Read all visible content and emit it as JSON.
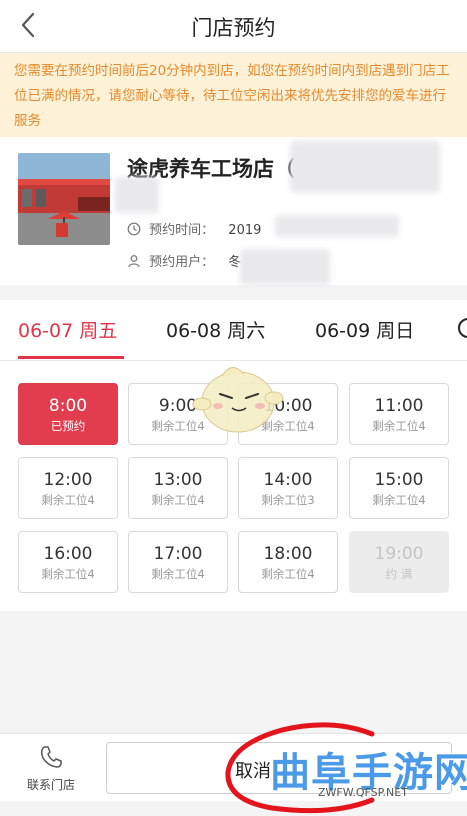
{
  "header": {
    "title": "门店预约"
  },
  "notice": {
    "text": "您需要在预约时间前后20分钟内到店，如您在预约时间内到店遇到门店工位已满的情况，请您耐心等待，待工位空闲出来将优先安排您的爱车进行服务"
  },
  "store": {
    "name": "途虎养车工场店（石",
    "time_label": "预约时间：",
    "time_value": "2019",
    "user_label": "预约用户：",
    "user_value": "冬"
  },
  "dates": [
    {
      "label": "06-07 周五",
      "active": true
    },
    {
      "label": "06-08 周六",
      "active": false
    },
    {
      "label": "06-09 周日",
      "active": false
    }
  ],
  "slots": [
    {
      "time": "8:00",
      "status": "已预约",
      "state": "booked"
    },
    {
      "time": "9:00",
      "status": "剩余工位4",
      "state": "open"
    },
    {
      "time": "10:00",
      "status": "剩余工位4",
      "state": "open"
    },
    {
      "time": "11:00",
      "status": "剩余工位4",
      "state": "open"
    },
    {
      "time": "12:00",
      "status": "剩余工位4",
      "state": "open"
    },
    {
      "time": "13:00",
      "status": "剩余工位4",
      "state": "open"
    },
    {
      "time": "14:00",
      "status": "剩余工位3",
      "state": "open"
    },
    {
      "time": "15:00",
      "status": "剩余工位4",
      "state": "open"
    },
    {
      "time": "16:00",
      "status": "剩余工位4",
      "state": "open"
    },
    {
      "time": "17:00",
      "status": "剩余工位4",
      "state": "open"
    },
    {
      "time": "18:00",
      "status": "剩余工位4",
      "state": "open"
    },
    {
      "time": "19:00",
      "status": "约 满",
      "state": "full"
    }
  ],
  "footer": {
    "contact_label": "联系门店",
    "cancel_label": "取消"
  },
  "watermark": {
    "brand": "曲阜手游网",
    "url": "ZWFW.QFSP.NET"
  },
  "colors": {
    "accent": "#e33348",
    "notice_bg": "#fdf2d8",
    "notice_text": "#e58a2c"
  },
  "icons": [
    "back-arrow-icon",
    "clock-icon",
    "user-icon",
    "phone-icon"
  ]
}
